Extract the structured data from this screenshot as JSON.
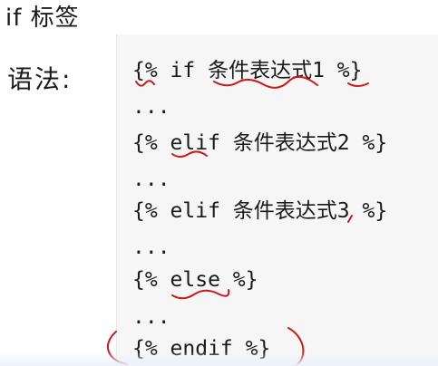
{
  "title": "if 标签",
  "syntax_label": "语法:",
  "code_lines": [
    "{% if 条件表达式1 %}",
    "...",
    "{% elif 条件表达式2 %}",
    "...",
    "{% elif 条件表达式3 %}",
    "...",
    "{% else %}",
    "...",
    "{% endif %}"
  ],
  "colors": {
    "annotation": "#d01818",
    "code_background": "#f6f6f6",
    "text": "#1a1a1a"
  }
}
